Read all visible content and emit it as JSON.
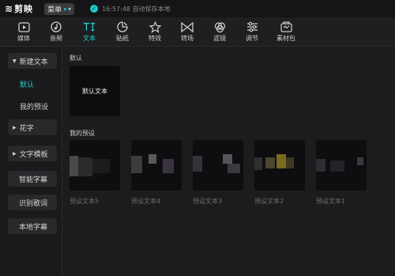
{
  "app": {
    "logo_mark": "≋",
    "name": "剪映"
  },
  "menu": {
    "label": "菜单",
    "chevron": "▾"
  },
  "status": {
    "text": "16:57:48 自动保存本地",
    "icon": "check-circle-icon"
  },
  "toolbar": {
    "tools": [
      {
        "label": "媒体",
        "icon": "media-icon"
      },
      {
        "label": "音频",
        "icon": "audio-icon"
      },
      {
        "label": "文本",
        "icon": "text-icon",
        "active": true
      },
      {
        "label": "贴纸",
        "icon": "sticker-icon"
      },
      {
        "label": "特效",
        "icon": "effects-icon"
      },
      {
        "label": "转场",
        "icon": "transition-icon"
      },
      {
        "label": "滤镜",
        "icon": "filter-icon"
      },
      {
        "label": "调节",
        "icon": "adjust-icon"
      },
      {
        "label": "素材包",
        "icon": "asset-pack-icon"
      }
    ]
  },
  "sidebar": {
    "new_text": "新建文本",
    "default": "默认",
    "my_presets": "我的预设",
    "fancy_text": "花字",
    "text_templates": "文字模板",
    "smart_captions": "智能字幕",
    "recognize_lyrics": "识别歌词",
    "local_captions": "本地字幕"
  },
  "main": {
    "default_section": "默认",
    "default_card": "默认文本",
    "preset_section": "我的预设",
    "presets": [
      "预设文本5",
      "预设文本4",
      "预设文本3",
      "预设文本2",
      "预设文本1"
    ]
  },
  "colors": {
    "accent": "#1ed2d2",
    "background": "#1c1c1e"
  }
}
